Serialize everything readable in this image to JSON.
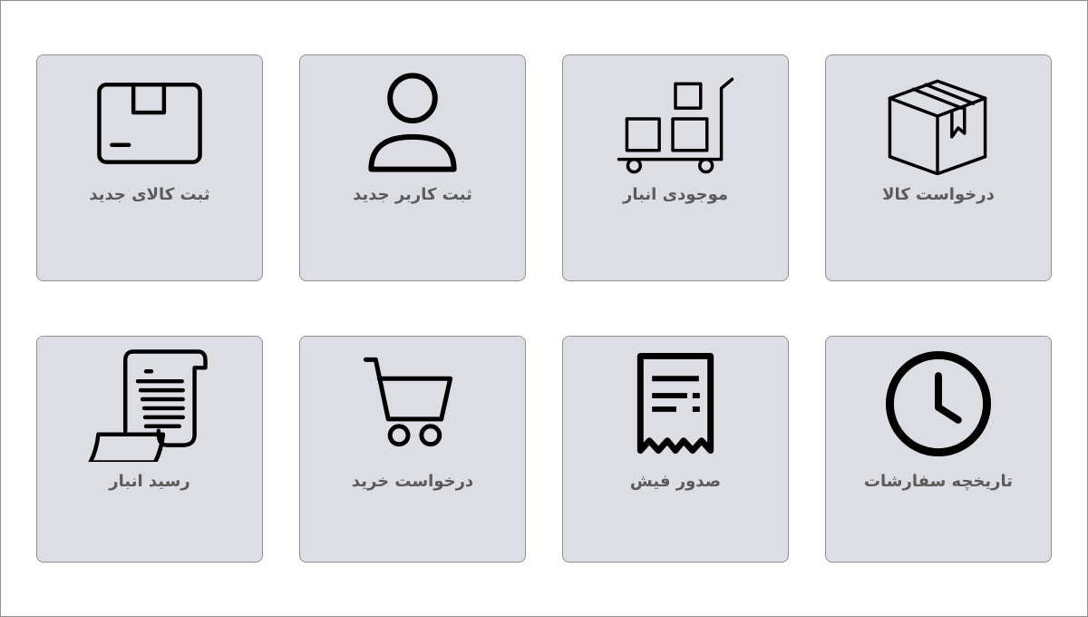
{
  "tiles": [
    {
      "label": "درخواست کالا",
      "icon": "box-icon"
    },
    {
      "label": "موجودی انبار",
      "icon": "hand-truck-icon"
    },
    {
      "label": "ثبت کاربر جدید",
      "icon": "user-icon"
    },
    {
      "label": "ثبت کالای جدید",
      "icon": "package-icon"
    },
    {
      "label": "تاریخچه سفارشات",
      "icon": "clock-icon"
    },
    {
      "label": "صدور فیش",
      "icon": "receipt-icon"
    },
    {
      "label": "درخواست خرید",
      "icon": "shopping-cart-icon"
    },
    {
      "label": "رسید انبار",
      "icon": "scroll-receipt-icon"
    }
  ]
}
